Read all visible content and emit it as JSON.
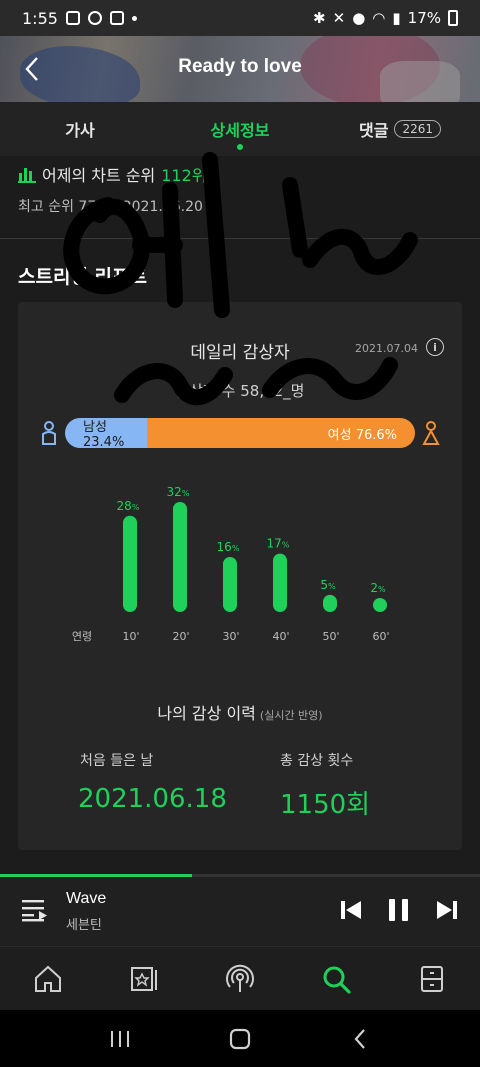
{
  "status_bar": {
    "time": "1:55",
    "battery": "17%"
  },
  "header": {
    "title": "Ready to love"
  },
  "tabs": [
    {
      "label": "가사"
    },
    {
      "label": "상세정보"
    },
    {
      "label": "댓글",
      "count": "2261"
    }
  ],
  "rank": {
    "yesterday_label": "어제의 차트 순위",
    "yesterday_value": "112위",
    "best": "최고 순위 77위 : 2021.06.20"
  },
  "report": {
    "section_title": "스트리밍 리포트",
    "card_title": "데일리 감상자",
    "date": "2021.07.04",
    "listeners": "감상자 수 58,92_명",
    "gender": {
      "male_label": "남성 23.4%",
      "female_label": "여성 76.6%",
      "male_fraction": 0.234
    },
    "age_label": "연령"
  },
  "chart_data": {
    "type": "bar",
    "categories": [
      "10'",
      "20'",
      "30'",
      "40'",
      "50'",
      "60'"
    ],
    "values": [
      28,
      32,
      16,
      17,
      5,
      2
    ],
    "unit": "%",
    "color": "#1fd15a"
  },
  "history": {
    "title": "나의 감상 이력",
    "note": "(실시간 반영)",
    "first_label": "처음 들은 날",
    "first_value": "2021.06.18",
    "count_label": "총 감상 횟수",
    "count_value": "1150회"
  },
  "player": {
    "title": "Wave",
    "artist": "세븐틴",
    "progress": 0.4
  },
  "colors": {
    "accent": "#1fd15a",
    "male": "#86b6f4",
    "female": "#f4902f"
  },
  "bottom_nav": [
    {
      "icon": "home-icon"
    },
    {
      "icon": "library-icon"
    },
    {
      "icon": "podcast-icon"
    },
    {
      "icon": "search-icon"
    },
    {
      "icon": "storage-icon"
    }
  ]
}
